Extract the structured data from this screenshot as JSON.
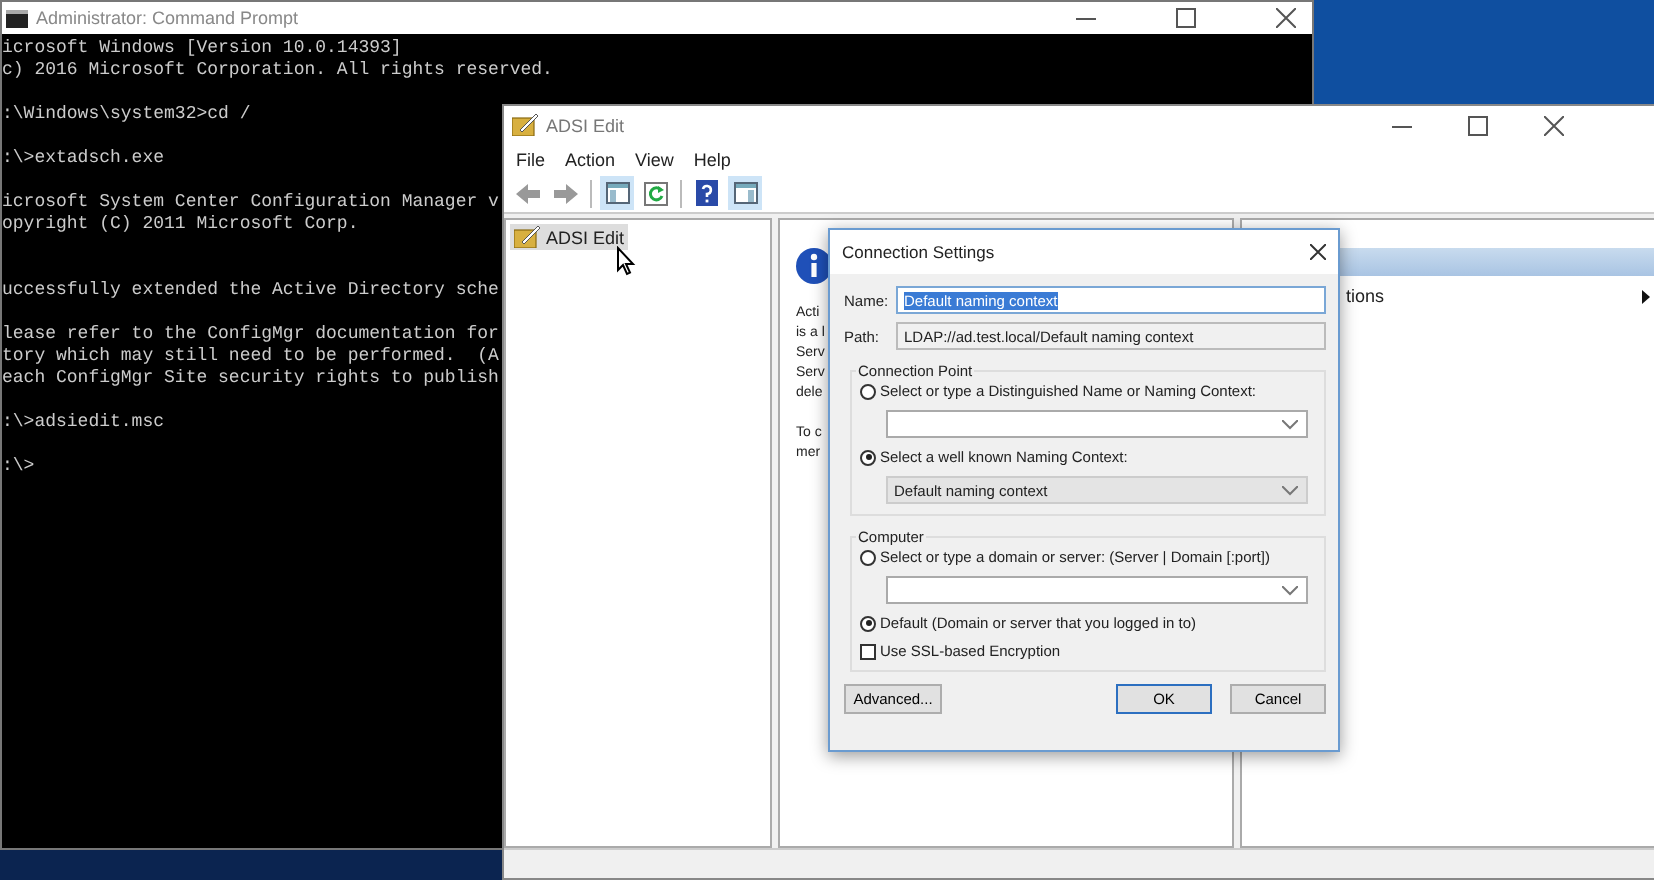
{
  "cmd_window": {
    "title": "Administrator: Command Prompt",
    "blocks": [
      [
        "icrosoft Windows [Version 10.0.14393]",
        "c) 2016 Microsoft Corporation. All rights reserved."
      ],
      [
        ":\\Windows\\system32>cd /"
      ],
      [
        ":\\>extadsch.exe"
      ],
      [
        "icrosoft System Center Configuration Manager v",
        "opyright (C) 2011 Microsoft Corp."
      ],
      [
        "uccessfully extended the Active Directory sche"
      ],
      [
        "lease refer to the ConfigMgr documentation for",
        "tory which may still need to be performed.  (A",
        "each ConfigMgr Site security rights to publish"
      ],
      [
        ":\\>adsiedit.msc"
      ],
      [
        ":\\>"
      ]
    ]
  },
  "adsi_window": {
    "title": "ADSI Edit",
    "menu": [
      "File",
      "Action",
      "View",
      "Help"
    ],
    "toolbar": [
      {
        "kind": "back",
        "disabled": true
      },
      {
        "kind": "forward",
        "disabled": true
      },
      {
        "kind": "tree",
        "pressed": true
      },
      {
        "kind": "refresh",
        "pressed": false
      },
      {
        "kind": "help",
        "pressed": false
      },
      {
        "kind": "pane",
        "pressed": true
      }
    ],
    "tree": [
      {
        "label": "ADSI Edit",
        "selected": true
      }
    ],
    "description": [
      {
        "lines": [
          "Acti",
          "is a l",
          "Serv",
          "Serv",
          "dele"
        ]
      },
      {
        "lines": [
          "To c",
          "mer"
        ]
      }
    ],
    "actions": {
      "items": [
        {
          "label": "tions",
          "submenu": true
        }
      ]
    }
  },
  "dialog": {
    "title": "Connection Settings",
    "name": {
      "label": "Name:",
      "value": "Default naming context",
      "highlighted": true
    },
    "path": {
      "label": "Path:",
      "value": "LDAP://ad.test.local/Default naming context"
    },
    "groups": [
      {
        "title": "Connection Point",
        "options": [
          {
            "label": "Select or type a Distinguished Name or Naming Context:",
            "selected": false,
            "combo": {
              "disabled": false
            }
          },
          {
            "label": "Select a well known Naming Context:",
            "selected": true,
            "combo": {
              "value": "Default naming context",
              "disabled": true
            }
          }
        ]
      },
      {
        "title": "Computer",
        "options": [
          {
            "label": "Select or type a domain or server: (Server | Domain [:port])",
            "selected": false,
            "combo": {
              "disabled": false
            }
          },
          {
            "label": "Default (Domain or server that you logged in to)",
            "selected": true
          }
        ],
        "checkbox": {
          "label": "Use SSL-based Encryption",
          "checked": false
        }
      }
    ],
    "buttons": [
      {
        "label": "Advanced...",
        "default": false
      },
      {
        "label": "OK",
        "default": true
      },
      {
        "label": "Cancel",
        "default": false
      }
    ]
  }
}
